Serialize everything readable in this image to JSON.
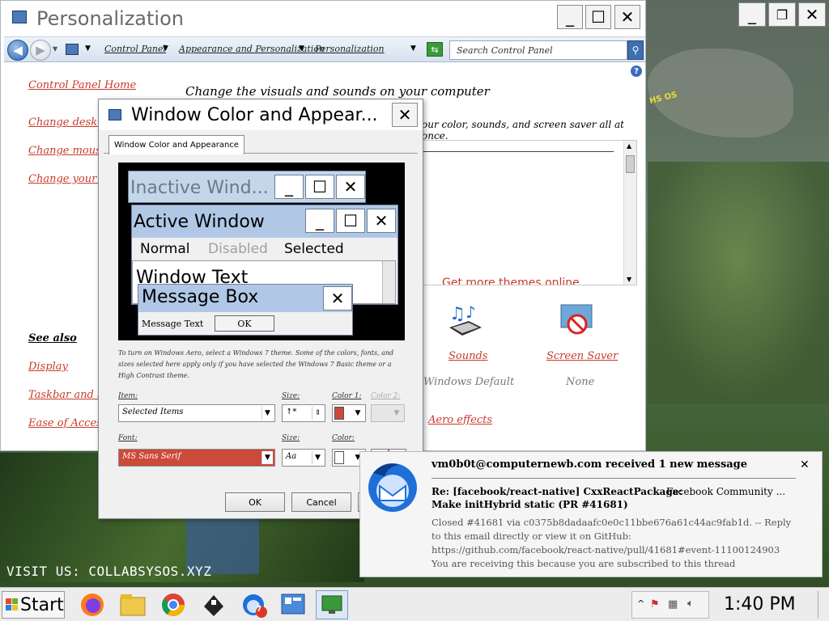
{
  "main_window": {
    "title": "Personalization",
    "address": {
      "crumbs": [
        "Control Panel",
        "Appearance and Personalization",
        "Personalization"
      ],
      "search_placeholder": "Search Control Panel"
    },
    "sidebar": {
      "home": "Control Panel Home",
      "items": [
        "Change desktop",
        "Change mouse p",
        "Change your acc"
      ],
      "see_also_heading": "See also",
      "see_also": [
        "Display",
        "Taskbar and S",
        "Ease of Acces"
      ]
    },
    "heading": "Change the visuals and sounds on your computer",
    "subheading": "our color, sounds, and screen saver all at once.",
    "themes_link": "Get more themes online",
    "tiles": {
      "sounds": {
        "label": "Sounds",
        "value": "Windows Default"
      },
      "screen_saver": {
        "label": "Screen Saver",
        "value": "None"
      }
    },
    "aero_link": "Aero effects",
    "desktop_badge": "HS OS"
  },
  "dialog": {
    "title": "Window Color and Appear...",
    "tab": "Window Color and Appearance",
    "preview": {
      "inactive_title": "Inactive Wind...",
      "active_title": "Active Window",
      "menu": [
        "Normal",
        "Disabled",
        "Selected"
      ],
      "window_text": "Window Text",
      "msgbox_title": "Message Box",
      "msgbox_text": "Message Text",
      "msgbox_ok": "OK"
    },
    "description": "To turn on Windows Aero, select a Windows 7 theme.  Some of the colors, fonts, and sizes selected here apply only if you have selected the Windows 7 Basic theme or a High Contrast theme.",
    "item_label": "Item:",
    "item_value": "Selected Items",
    "size_label": "Size:",
    "color1_label": "Color 1:",
    "color2_label": "Color 2:",
    "font_label": "Font:",
    "font_value": "MS Sans Serif",
    "font_size_label": "Size:",
    "font_color_label": "Color:",
    "ok_button": "OK",
    "cancel_button": "Cancel",
    "item_color": "#cc4a3a"
  },
  "notification": {
    "header": "vm0b0t@computernewb.com received 1 new message",
    "subject_line1": "Re: [facebook/react-native] CxxReactPackage:",
    "subject_line2": "Make initHybrid static (PR #41681)",
    "sender": "Facebook Community ...",
    "body": "Closed #41681 via c0375b8dadaafc0e0c11bbe676a61c44ac9fab1d. -- Reply to this email directly or view it on GitHub: https://github.com/facebook/react-native/pull/41681#event-11100124903 You are receiving this because you are subscribed to this thread"
  },
  "watermark": "VISIT US: COLLABSYSOS.XYZ",
  "taskbar": {
    "start_label": "Start",
    "clock": "1:40 PM",
    "thunderbird_badge": "7"
  }
}
